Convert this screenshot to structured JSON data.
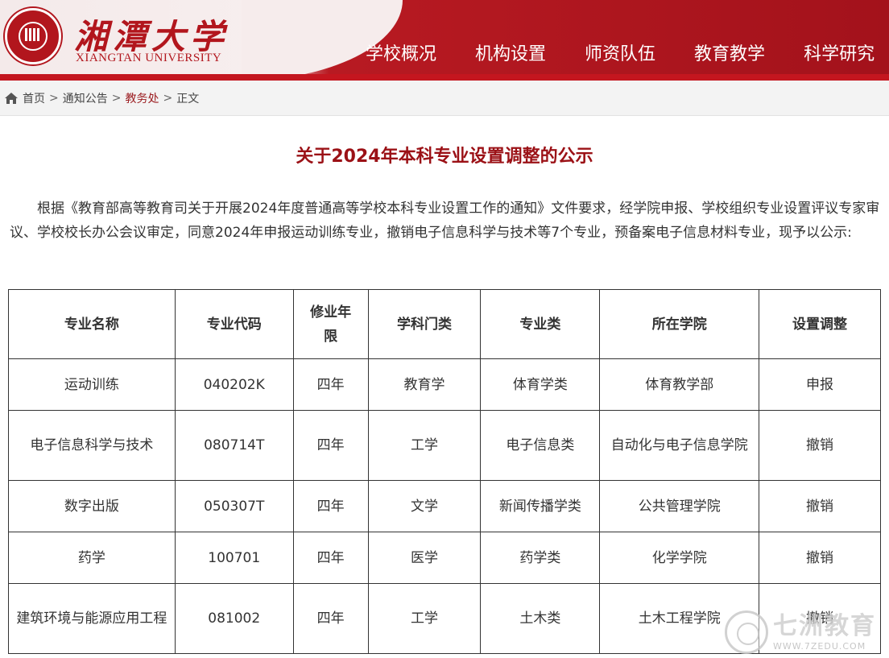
{
  "header": {
    "logo_name_cn": "湘潭大学",
    "logo_name_en": "XIANGTAN UNIVERSITY",
    "seal_text": "XIANGTAN UNIVERSITY 1958 湘潭大学",
    "brand_color": "#b2161d",
    "nav": [
      "学校概况",
      "机构设置",
      "师资队伍",
      "教育教学",
      "科学研究"
    ]
  },
  "breadcrumb": {
    "items": [
      "首页",
      "通知公告",
      "教务处",
      "正文"
    ],
    "separator": ">",
    "home_icon": "home-icon"
  },
  "article": {
    "title": "关于2024年本科专业设置调整的公示",
    "intro": "根据《教育部高等教育司关于开展2024年度普通高等学校本科专业设置工作的通知》文件要求，经学院申报、学校组织专业设置评议专家审议、学校校长办公会议审定，同意2024年申报运动训练专业，撤销电子信息科学与技术等7个专业，预备案电子信息材料专业，现予以公示:"
  },
  "table": {
    "headers": [
      "专业名称",
      "专业代码",
      "修业年限",
      "学科门类",
      "专业类",
      "所在学院",
      "设置调整"
    ],
    "rows": [
      [
        "运动训练",
        "040202K",
        "四年",
        "教育学",
        "体育学类",
        "体育教学部",
        "申报"
      ],
      [
        "电子信息科学与技术",
        "080714T",
        "四年",
        "工学",
        "电子信息类",
        "自动化与电子信息学院",
        "撤销"
      ],
      [
        "数字出版",
        "050307T",
        "四年",
        "文学",
        "新闻传播学类",
        "公共管理学院",
        "撤销"
      ],
      [
        "药学",
        "100701",
        "四年",
        "医学",
        "药学类",
        "化学学院",
        "撤销"
      ],
      [
        "建筑环境与能源应用工程",
        "081002",
        "四年",
        "工学",
        "土木类",
        "土木工程学院",
        "撤销"
      ]
    ]
  },
  "watermark": {
    "cn": "七洲教育",
    "url": "WWW.7ZEDU.COM"
  }
}
